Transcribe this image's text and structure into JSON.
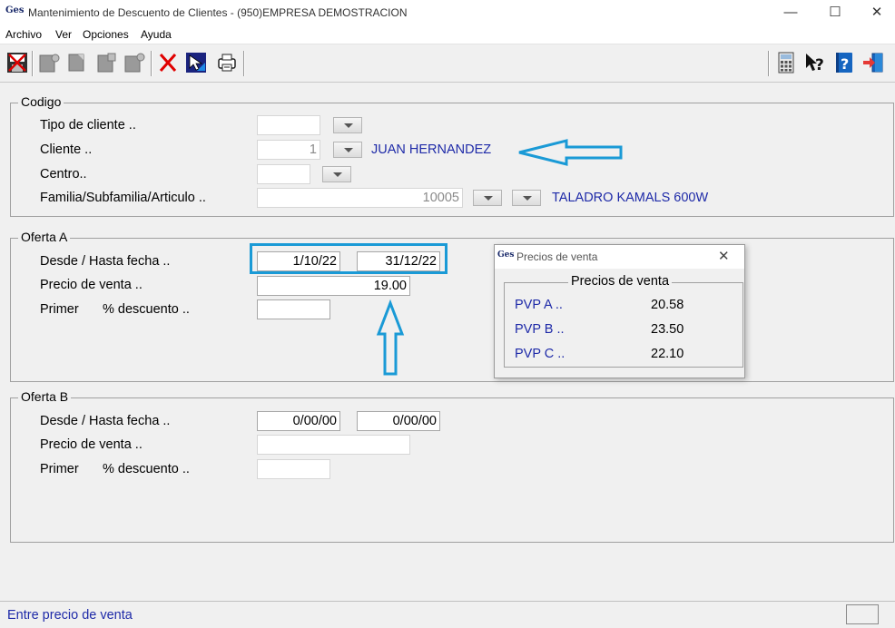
{
  "window": {
    "app_logo": "Ges",
    "title": "Mantenimiento de Descuento de Clientes -  (950)EMPRESA DEMOSTRACION",
    "controls": {
      "minimize": "—",
      "maximize": "☐",
      "close": "✕"
    }
  },
  "menu": [
    "Archivo",
    "Ver",
    "Opciones",
    "Ayuda"
  ],
  "toolbar": {
    "icons": [
      "save-exit-icon",
      "doc-icon",
      "doc-icon",
      "doc-icon",
      "doc-icon",
      "delete-icon",
      "pointer-icon",
      "print-icon",
      "calculator-icon",
      "help-pointer-icon",
      "help-book-icon",
      "exit-door-icon"
    ],
    "colors": {
      "delete": "#e00000",
      "accent": "#1565c0"
    }
  },
  "codigo": {
    "legend": "Codigo",
    "tipo_label": "Tipo de cliente ..",
    "tipo_value": "",
    "cliente_label": "Cliente ..",
    "cliente_value": "1",
    "cliente_name": "JUAN HERNANDEZ",
    "centro_label": "Centro..",
    "centro_value": "",
    "familia_label": "Familia/Subfamilia/Articulo ..",
    "familia_value": "10005",
    "articulo_name": "TALADRO KAMALS 600W"
  },
  "oferta_a": {
    "legend": "Oferta A",
    "fecha_label": "Desde / Hasta fecha ..",
    "desde": "1/10/22",
    "hasta": "31/12/22",
    "precio_label": "Precio de venta ..",
    "precio": "19.00",
    "primer_label": "Primer",
    "descuento_label": "% descuento ..",
    "descuento": ""
  },
  "oferta_b": {
    "legend": "Oferta B",
    "fecha_label": "Desde / Hasta fecha ..",
    "desde": "0/00/00",
    "hasta": "0/00/00",
    "precio_label": "Precio de venta ..",
    "precio": "",
    "primer_label": "Primer",
    "descuento_label": "% descuento ..",
    "descuento": ""
  },
  "popup": {
    "logo": "Ges",
    "title": "Precios de venta",
    "close": "✕",
    "group_title": "Precios de venta",
    "rows": [
      {
        "label": "PVP A ..",
        "value": "20.58"
      },
      {
        "label": "PVP B ..",
        "value": "23.50"
      },
      {
        "label": "PVP C ..",
        "value": "22.10"
      }
    ]
  },
  "status": {
    "text": "Entre precio de venta"
  },
  "annotation_color": "#1a9ad6"
}
